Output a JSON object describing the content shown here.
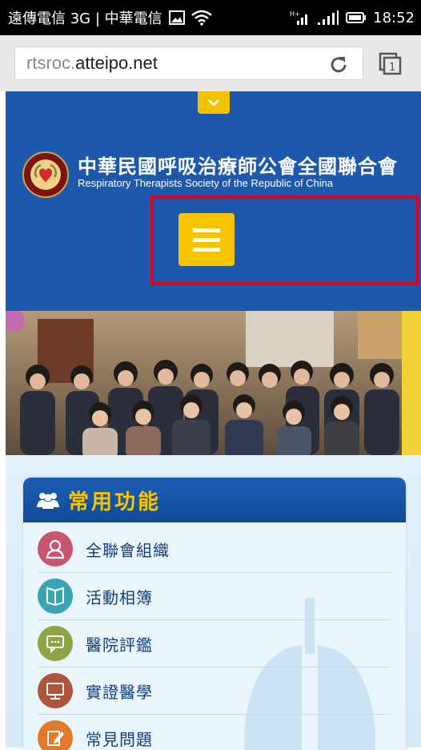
{
  "status_bar": {
    "carriers": "遠傳電信 3G | 中華電信",
    "time": "18:52"
  },
  "browser": {
    "url_prefix": "rtsroc.",
    "url_domain": "atteipo.net",
    "tab_count": "1"
  },
  "site": {
    "title_zh": "中華民國呼吸治療師公會全國聯合會",
    "title_en": "Respiratory Therapists Society of the Republic of China"
  },
  "panel": {
    "title": "常用功能",
    "items": [
      {
        "label": "全聯會組織",
        "icon": "person-icon",
        "color": "#c9546f"
      },
      {
        "label": "活動相簿",
        "icon": "book-icon",
        "color": "#3aa3b5"
      },
      {
        "label": "醫院評鑑",
        "icon": "chat-icon",
        "color": "#8fa443"
      },
      {
        "label": "實證醫學",
        "icon": "monitor-icon",
        "color": "#b0533b"
      },
      {
        "label": "常見問題",
        "icon": "pencil-icon",
        "color": "#e37a2a"
      }
    ]
  },
  "colors": {
    "header_blue": "#1c59ac",
    "accent_yellow": "#f7c400",
    "highlight_red": "#e0001b"
  }
}
